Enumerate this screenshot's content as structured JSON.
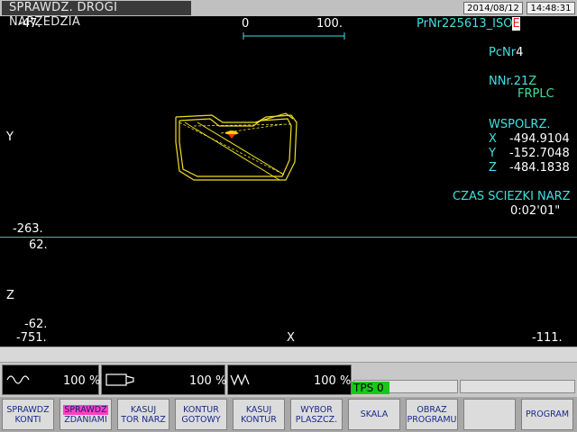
{
  "title": "SPRAWDZ. DROGI NARZEDZIA",
  "date": "2014/08/12",
  "time": "14:48:31",
  "upper_view": {
    "top_left_value": "-47.",
    "scale_left": "0",
    "scale_right": "100.",
    "axis_label": "Y",
    "bottom_left_value": "-263."
  },
  "lower_view": {
    "top_value": "62.",
    "axis_label": "Z",
    "bottom_value": "-62.",
    "x_left": "-751.",
    "x_axis_label": "X",
    "x_right": "-111."
  },
  "program": {
    "prnr_prefix": "PrNr",
    "prnr_value": "225613_ISO",
    "prnr_suffix": "E",
    "pcnr_label": "PcNr",
    "pcnr_value": "4",
    "nnr_label": "NNr.21",
    "nnr_suffix": "Z",
    "tool_name": "FRPLC"
  },
  "coordinates": {
    "label": "WSPOLRZ.",
    "x_label": "X",
    "x_value": "-494.9104",
    "y_label": "Y",
    "y_value": "-152.7048",
    "z_label": "Z",
    "z_value": "-484.1838"
  },
  "path_time": {
    "label": "CZAS SCIEZKI NARZ",
    "value": "0:02'01\""
  },
  "overrides": {
    "spindle": "100 %",
    "feed": "100 %",
    "rapid": "100 %"
  },
  "tps_label": "TPS 0",
  "softkeys": [
    {
      "line1": "SPRAWDZ",
      "line2": "KONTI"
    },
    {
      "line1": "SPRAWDZ",
      "line2": "ZDANIAMI"
    },
    {
      "line1": "KASUJ",
      "line2": "TOR NARZ"
    },
    {
      "line1": "KONTUR",
      "line2": "GOTOWY"
    },
    {
      "line1": "KASUJ",
      "line2": "KONTUR"
    },
    {
      "line1": "WYBOR",
      "line2": "PLASZCZ."
    },
    {
      "line1": "SKALA",
      "line2": ""
    },
    {
      "line1": "OBRAZ",
      "line2": "PROGRAMU"
    },
    {
      "line1": "",
      "line2": ""
    },
    {
      "line1": "PROGRAM",
      "line2": ""
    }
  ],
  "colors": {
    "background": "#000000",
    "text_white": "#ffffff",
    "text_cyan": "#40e0e0",
    "path_yellow": "#f0e020",
    "highlight_magenta": "#ff40c0",
    "tps_green": "#18c818"
  }
}
